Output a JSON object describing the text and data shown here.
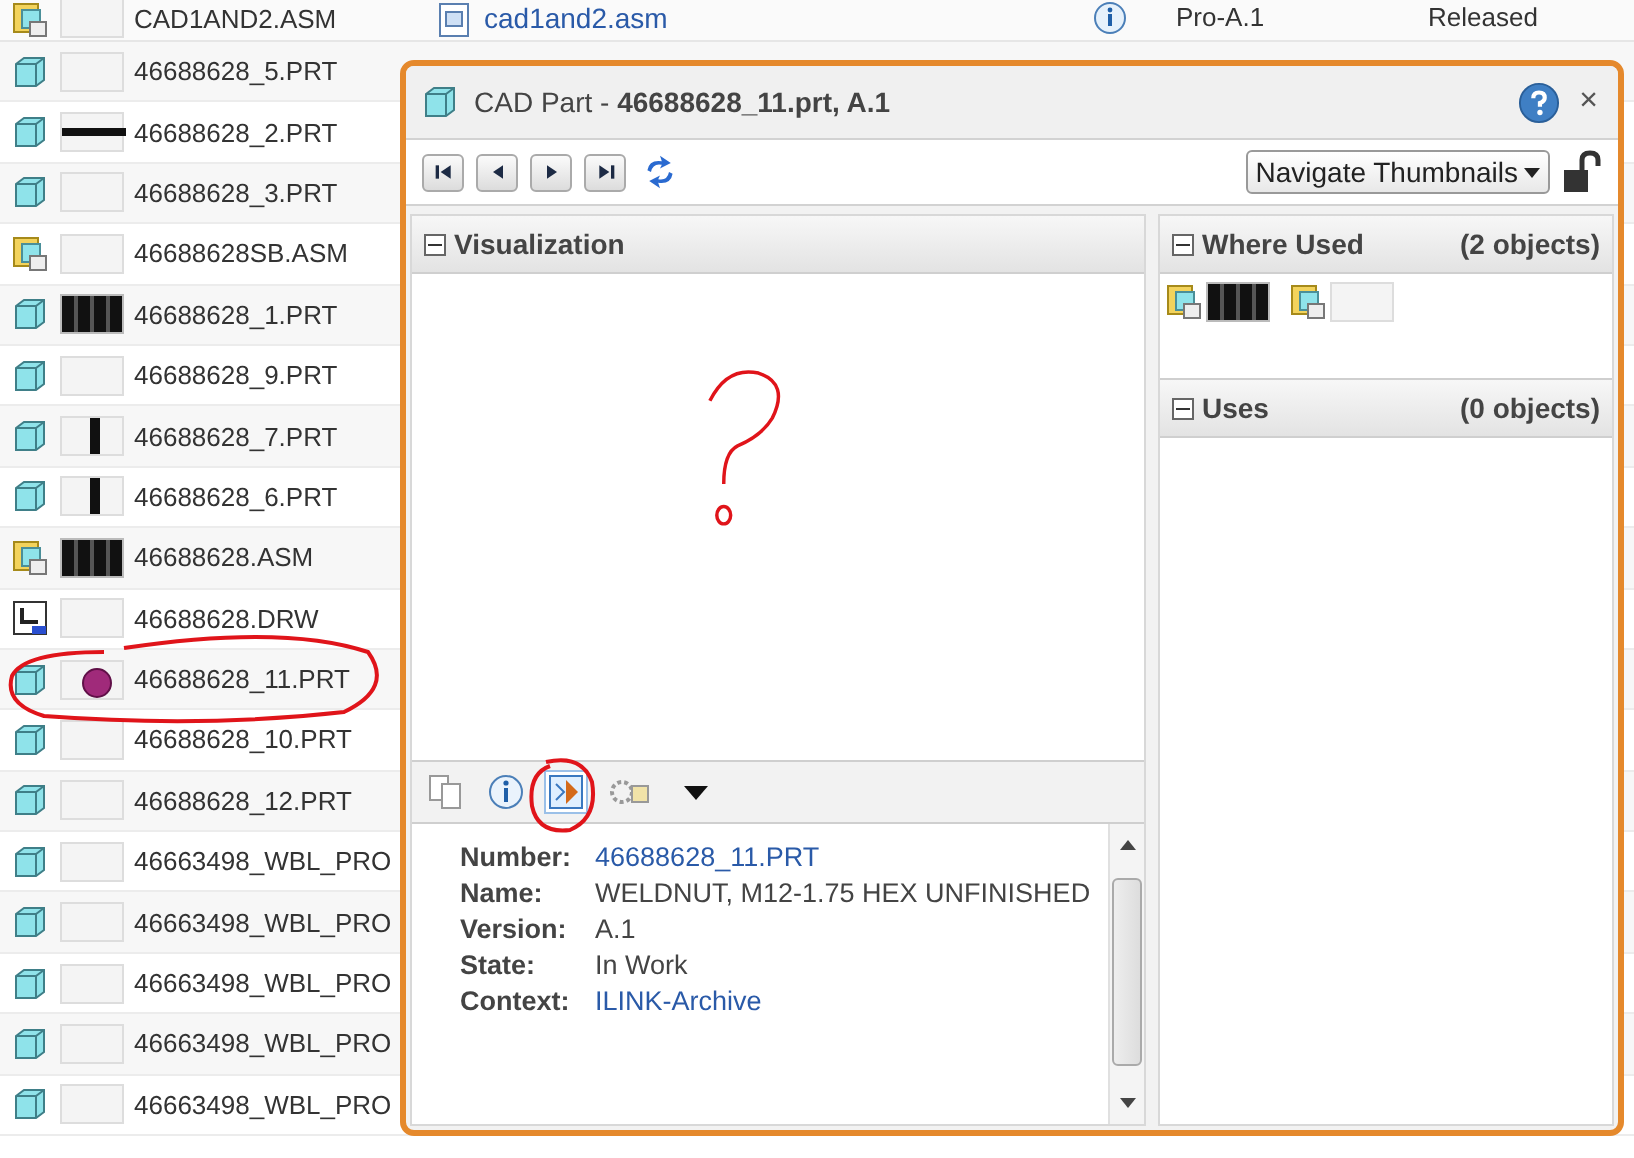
{
  "top_row": {
    "name": "CAD1AND2.ASM",
    "kind": "assembly",
    "file": "cad1and2.asm",
    "version": "Pro-A.1",
    "state": "Released"
  },
  "list": [
    {
      "name": "46688628_5.PRT",
      "kind": "part",
      "thumbnail": {
        "kind": "blank"
      }
    },
    {
      "name": "46688628_2.PRT",
      "kind": "part",
      "thumbnail": {
        "kind": "strip"
      }
    },
    {
      "name": "46688628_3.PRT",
      "kind": "part",
      "thumbnail": {
        "kind": "blank"
      }
    },
    {
      "name": "46688628SB.ASM",
      "kind": "assembly",
      "thumbnail": {
        "kind": "blank"
      }
    },
    {
      "name": "46688628_1.PRT",
      "kind": "part",
      "thumbnail": {
        "kind": "dark"
      }
    },
    {
      "name": "46688628_9.PRT",
      "kind": "part",
      "thumbnail": {
        "kind": "blank"
      }
    },
    {
      "name": "46688628_7.PRT",
      "kind": "part",
      "thumbnail": {
        "kind": "bar"
      }
    },
    {
      "name": "46688628_6.PRT",
      "kind": "part",
      "thumbnail": {
        "kind": "bar"
      }
    },
    {
      "name": "46688628.ASM",
      "kind": "assembly",
      "thumbnail": {
        "kind": "dark"
      }
    },
    {
      "name": "46688628.DRW",
      "kind": "drawing",
      "thumbnail": {
        "kind": "blank"
      }
    },
    {
      "name": "46688628_11.PRT",
      "kind": "part",
      "thumbnail": {
        "kind": "pink"
      }
    },
    {
      "name": "46688628_10.PRT",
      "kind": "part",
      "thumbnail": {
        "kind": "blank"
      }
    },
    {
      "name": "46688628_12.PRT",
      "kind": "part",
      "thumbnail": {
        "kind": "blank"
      }
    },
    {
      "name": "46663498_WBL_PRO",
      "kind": "part",
      "thumbnail": {
        "kind": "blank"
      }
    },
    {
      "name": "46663498_WBL_PRO",
      "kind": "part",
      "thumbnail": {
        "kind": "blank"
      }
    },
    {
      "name": "46663498_WBL_PRO",
      "kind": "part",
      "thumbnail": {
        "kind": "blank"
      }
    },
    {
      "name": "46663498_WBL_PRO",
      "kind": "part",
      "thumbnail": {
        "kind": "blank"
      }
    },
    {
      "name": "46663498_WBL_PRO",
      "kind": "part",
      "thumbnail": {
        "kind": "blank"
      }
    }
  ],
  "dialog": {
    "title_prefix": "CAD Part - ",
    "title_object": "46688628_11.prt, A.1",
    "close": "×",
    "nav_menu": "Navigate Thumbnails",
    "locked": false,
    "visualization": {
      "title": "Visualization",
      "expanded": true
    },
    "tools": [
      {
        "kind": "copy",
        "selected": false
      },
      {
        "kind": "info",
        "selected": false
      },
      {
        "kind": "thumbnail",
        "selected": true
      },
      {
        "kind": "structure",
        "selected": false
      }
    ],
    "details": [
      {
        "label": "Number:",
        "value": "46688628_11.PRT",
        "kind": "link"
      },
      {
        "label": "Name:",
        "value": "WELDNUT, M12-1.75 HEX UNFINISHED",
        "kind": "text"
      },
      {
        "label": "Version:",
        "value": "A.1",
        "kind": "text"
      },
      {
        "label": "State:",
        "value": "In Work",
        "kind": "text"
      },
      {
        "label": "Context:",
        "value": "ILINK-Archive",
        "kind": "link"
      }
    ],
    "where_used": {
      "title": "Where Used",
      "count": "(2 objects)",
      "expanded": true,
      "items": [
        {
          "kind": "assembly",
          "thumbnail": {
            "kind": "dark"
          }
        },
        {
          "kind": "assembly",
          "thumbnail": {
            "kind": "blank"
          }
        }
      ]
    },
    "uses": {
      "title": "Uses",
      "count": "(0 objects)",
      "expanded": true
    }
  }
}
